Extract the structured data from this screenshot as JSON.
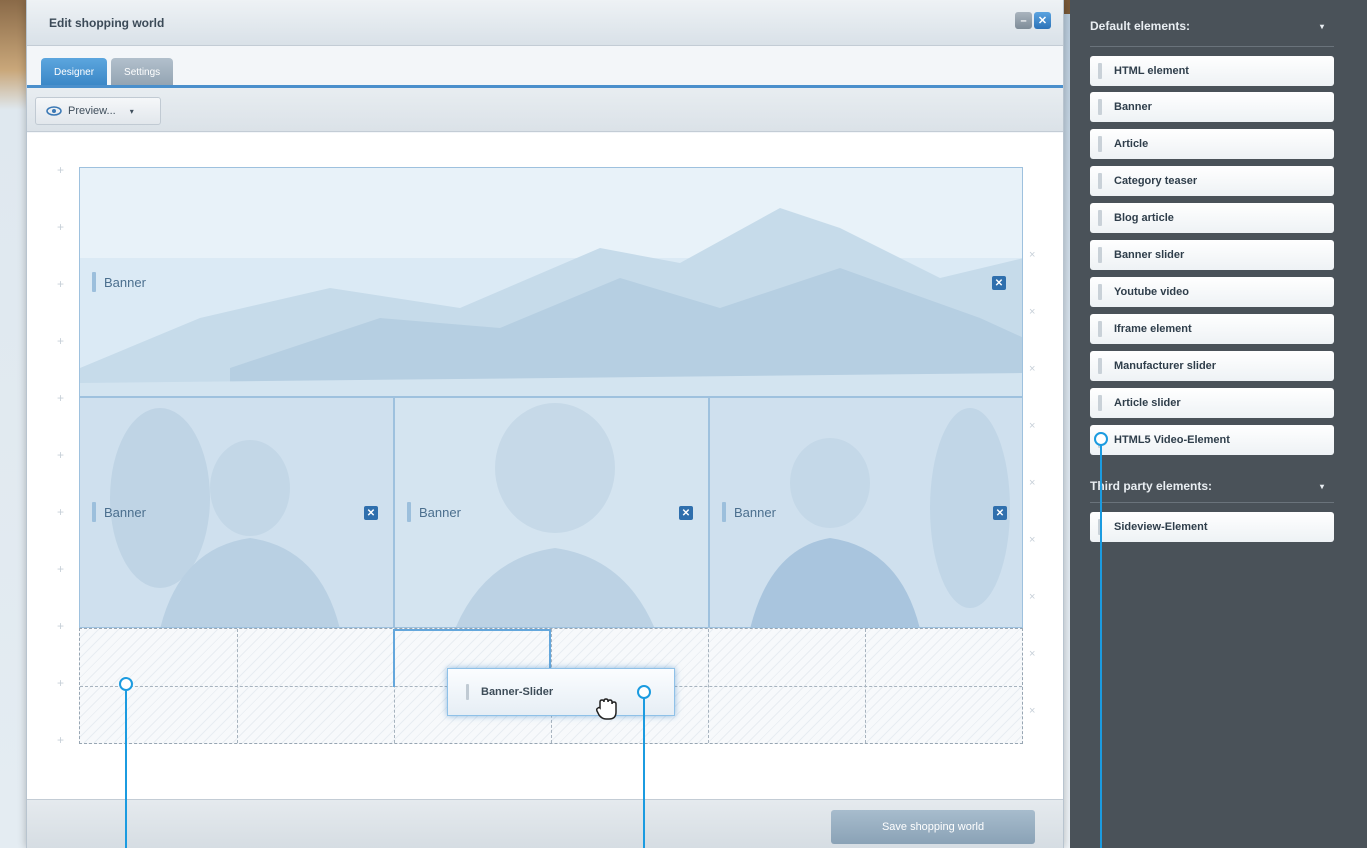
{
  "window": {
    "title": "Edit shopping world",
    "min_label": "–",
    "close_label": "✕"
  },
  "tabs": [
    {
      "label": "Designer",
      "active": true
    },
    {
      "label": "Settings",
      "active": false
    }
  ],
  "toolbar": {
    "preview_label": "Preview...",
    "preview_caret": "▾",
    "preview_icon": "eye-icon"
  },
  "canvas": {
    "grid_plus": "+",
    "row_delete": "×",
    "elements": [
      {
        "label": "Banner",
        "remove": "✕"
      },
      {
        "label": "Banner",
        "remove": "✕"
      },
      {
        "label": "Banner",
        "remove": "✕"
      },
      {
        "label": "Banner",
        "remove": "✕"
      }
    ],
    "dragging_label": "Banner-Slider"
  },
  "footer": {
    "save_label": "Save shopping world"
  },
  "panel": {
    "default_heading": "Default elements:",
    "default_items": [
      "HTML element",
      "Banner",
      "Article",
      "Category teaser",
      "Blog article",
      "Banner slider",
      "Youtube video",
      "Iframe element",
      "Manufacturer slider",
      "Article slider",
      "HTML5 Video-Element"
    ],
    "third_party_heading": "Third party elements:",
    "third_party_items": [
      "Sideview-Element"
    ],
    "collapse_arrow": "▾"
  },
  "colors": {
    "accent": "#3a86c6",
    "panel_bg": "#4a5259",
    "callout": "#1b9be0"
  }
}
